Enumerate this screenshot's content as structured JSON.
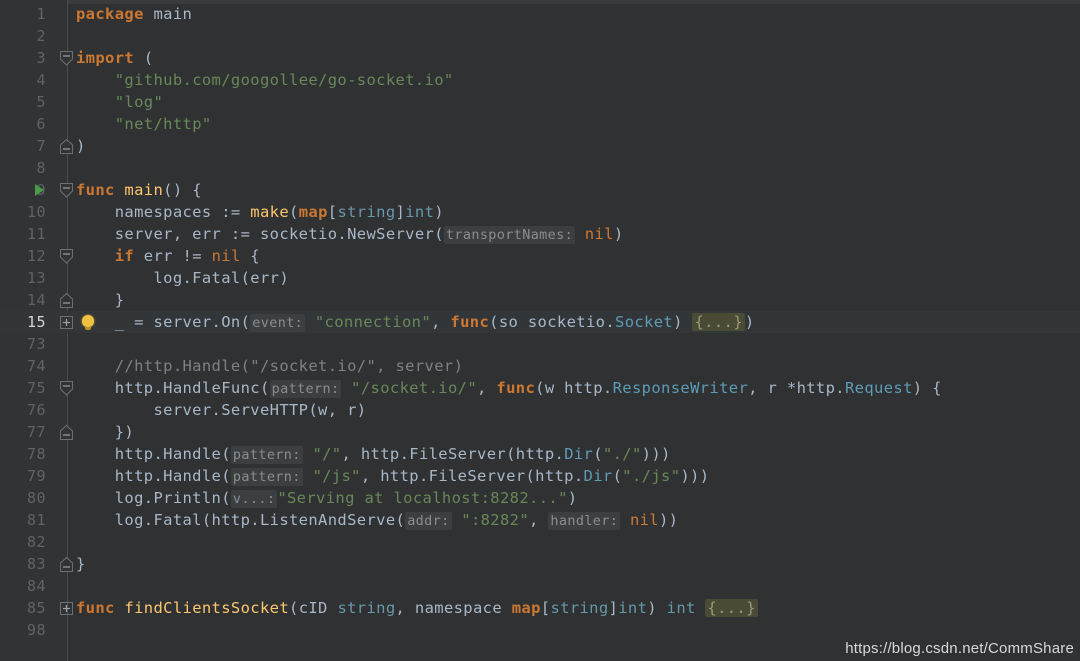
{
  "app": {
    "type": "code-editor",
    "language": "Go",
    "theme": "Darcula",
    "background": "#2f3133",
    "gutter_background": "#313335",
    "current_line_background": "#323639",
    "default_text_color": "#a9b7c6"
  },
  "colors": {
    "keyword": "#cc7832",
    "string": "#6a8759",
    "comment": "#808080",
    "type": "#6897a8",
    "function": "#ffc66d",
    "parameter_hint_bg": "#3c3f41",
    "parameter_hint_fg": "#8c8c8c",
    "folded_block_bg": "#4a4b35",
    "run_marker": "#4a9c4a",
    "bulb": "#f0c040",
    "line_number": "#606366",
    "current_line_number": "#d6d6d6"
  },
  "gutter": {
    "run_marker_line": 9,
    "bulb_line": 15,
    "fold_markers": [
      {
        "line": 3,
        "state": "expanded-start"
      },
      {
        "line": 7,
        "state": "expanded-end"
      },
      {
        "line": 9,
        "state": "expanded-start"
      },
      {
        "line": 12,
        "state": "expanded-start"
      },
      {
        "line": 14,
        "state": "expanded-end"
      },
      {
        "line": 15,
        "state": "collapsed"
      },
      {
        "line": 75,
        "state": "expanded-start"
      },
      {
        "line": 77,
        "state": "expanded-end"
      },
      {
        "line": 83,
        "state": "expanded-end"
      },
      {
        "line": 85,
        "state": "collapsed"
      }
    ]
  },
  "editor": {
    "current_line": 15,
    "lines": [
      {
        "n": "1",
        "tokens": [
          {
            "t": "package",
            "c": "kw"
          },
          {
            "t": " main",
            "c": "plain"
          }
        ]
      },
      {
        "n": "2",
        "tokens": []
      },
      {
        "n": "3",
        "tokens": [
          {
            "t": "import",
            "c": "kw"
          },
          {
            "t": " (",
            "c": "plain"
          }
        ]
      },
      {
        "n": "4",
        "tokens": [
          {
            "t": "    ",
            "c": "plain"
          },
          {
            "t": "\"github.com/googollee/go-socket.io\"",
            "c": "str"
          }
        ]
      },
      {
        "n": "5",
        "tokens": [
          {
            "t": "    ",
            "c": "plain"
          },
          {
            "t": "\"log\"",
            "c": "str"
          }
        ]
      },
      {
        "n": "6",
        "tokens": [
          {
            "t": "    ",
            "c": "plain"
          },
          {
            "t": "\"net/http\"",
            "c": "str"
          }
        ]
      },
      {
        "n": "7",
        "tokens": [
          {
            "t": ")",
            "c": "plain"
          }
        ]
      },
      {
        "n": "8",
        "tokens": []
      },
      {
        "n": "9",
        "tokens": [
          {
            "t": "func",
            "c": "kw"
          },
          {
            "t": " ",
            "c": "plain"
          },
          {
            "t": "main",
            "c": "fn"
          },
          {
            "t": "() {",
            "c": "plain"
          }
        ]
      },
      {
        "n": "10",
        "tokens": [
          {
            "t": "    namespaces := ",
            "c": "plain"
          },
          {
            "t": "make",
            "c": "builtin"
          },
          {
            "t": "(",
            "c": "plain"
          },
          {
            "t": "map",
            "c": "kw"
          },
          {
            "t": "[",
            "c": "plain"
          },
          {
            "t": "string",
            "c": "type"
          },
          {
            "t": "]",
            "c": "plain"
          },
          {
            "t": "int",
            "c": "type"
          },
          {
            "t": ")",
            "c": "plain"
          }
        ]
      },
      {
        "n": "11",
        "tokens": [
          {
            "t": "    server, err := socketio.NewServer(",
            "c": "plain"
          },
          {
            "t": "transportNames:",
            "c": "hint"
          },
          {
            "t": " ",
            "c": "plain"
          },
          {
            "t": "nil",
            "c": "kw2"
          },
          {
            "t": ")",
            "c": "plain"
          }
        ]
      },
      {
        "n": "12",
        "tokens": [
          {
            "t": "    ",
            "c": "plain"
          },
          {
            "t": "if",
            "c": "kw"
          },
          {
            "t": " err != ",
            "c": "plain"
          },
          {
            "t": "nil",
            "c": "kw2"
          },
          {
            "t": " {",
            "c": "plain"
          }
        ]
      },
      {
        "n": "13",
        "tokens": [
          {
            "t": "        log.Fatal(err)",
            "c": "plain"
          }
        ]
      },
      {
        "n": "14",
        "tokens": [
          {
            "t": "    }",
            "c": "plain"
          }
        ]
      },
      {
        "n": "15",
        "tokens": [
          {
            "t": "    _ = server.On(",
            "c": "plain"
          },
          {
            "t": "event:",
            "c": "hint"
          },
          {
            "t": " ",
            "c": "plain"
          },
          {
            "t": "\"connection\"",
            "c": "str"
          },
          {
            "t": ", ",
            "c": "plain"
          },
          {
            "t": "func",
            "c": "kw"
          },
          {
            "t": "(so socketio.",
            "c": "plain"
          },
          {
            "t": "Socket",
            "c": "typ2"
          },
          {
            "t": ") ",
            "c": "plain"
          },
          {
            "t": "{...}",
            "c": "fold-inline"
          },
          {
            "t": ")",
            "c": "plain"
          }
        ]
      },
      {
        "n": "73",
        "tokens": []
      },
      {
        "n": "74",
        "tokens": [
          {
            "t": "    //http.Handle(\"/socket.io/\", server)",
            "c": "cmt"
          }
        ]
      },
      {
        "n": "75",
        "tokens": [
          {
            "t": "    http.HandleFunc(",
            "c": "plain"
          },
          {
            "t": "pattern:",
            "c": "hint"
          },
          {
            "t": " ",
            "c": "plain"
          },
          {
            "t": "\"/socket.io/\"",
            "c": "str"
          },
          {
            "t": ", ",
            "c": "plain"
          },
          {
            "t": "func",
            "c": "kw"
          },
          {
            "t": "(w http.",
            "c": "plain"
          },
          {
            "t": "ResponseWriter",
            "c": "typ2"
          },
          {
            "t": ", r *http.",
            "c": "plain"
          },
          {
            "t": "Request",
            "c": "typ2"
          },
          {
            "t": ") {",
            "c": "plain"
          }
        ]
      },
      {
        "n": "76",
        "tokens": [
          {
            "t": "        server.ServeHTTP(w, r)",
            "c": "plain"
          }
        ]
      },
      {
        "n": "77",
        "tokens": [
          {
            "t": "    })",
            "c": "plain"
          }
        ]
      },
      {
        "n": "78",
        "tokens": [
          {
            "t": "    http.Handle(",
            "c": "plain"
          },
          {
            "t": "pattern:",
            "c": "hint"
          },
          {
            "t": " ",
            "c": "plain"
          },
          {
            "t": "\"/\"",
            "c": "str"
          },
          {
            "t": ", http.",
            "c": "plain"
          },
          {
            "t": "FileServer",
            "c": "plain"
          },
          {
            "t": "(http.",
            "c": "plain"
          },
          {
            "t": "Dir",
            "c": "typ2"
          },
          {
            "t": "(",
            "c": "plain"
          },
          {
            "t": "\"./\"",
            "c": "str"
          },
          {
            "t": ")))",
            "c": "plain"
          }
        ]
      },
      {
        "n": "79",
        "tokens": [
          {
            "t": "    http.Handle(",
            "c": "plain"
          },
          {
            "t": "pattern:",
            "c": "hint"
          },
          {
            "t": " ",
            "c": "plain"
          },
          {
            "t": "\"/js\"",
            "c": "str"
          },
          {
            "t": ", http.FileServer(http.",
            "c": "plain"
          },
          {
            "t": "Dir",
            "c": "typ2"
          },
          {
            "t": "(",
            "c": "plain"
          },
          {
            "t": "\"./js\"",
            "c": "str"
          },
          {
            "t": ")))",
            "c": "plain"
          }
        ]
      },
      {
        "n": "80",
        "tokens": [
          {
            "t": "    log.Println(",
            "c": "plain"
          },
          {
            "t": "v...:",
            "c": "hint"
          },
          {
            "t": "\"Serving at localhost:8282...\"",
            "c": "str"
          },
          {
            "t": ")",
            "c": "plain"
          }
        ]
      },
      {
        "n": "81",
        "tokens": [
          {
            "t": "    log.Fatal(http.ListenAndServe(",
            "c": "plain"
          },
          {
            "t": "addr:",
            "c": "hint"
          },
          {
            "t": " ",
            "c": "plain"
          },
          {
            "t": "\":8282\"",
            "c": "str"
          },
          {
            "t": ", ",
            "c": "plain"
          },
          {
            "t": "handler:",
            "c": "hint"
          },
          {
            "t": " ",
            "c": "plain"
          },
          {
            "t": "nil",
            "c": "kw2"
          },
          {
            "t": "))",
            "c": "plain"
          }
        ]
      },
      {
        "n": "82",
        "tokens": []
      },
      {
        "n": "83",
        "tokens": [
          {
            "t": "}",
            "c": "plain"
          }
        ]
      },
      {
        "n": "84",
        "tokens": []
      },
      {
        "n": "85",
        "tokens": [
          {
            "t": "func",
            "c": "kw"
          },
          {
            "t": " ",
            "c": "plain"
          },
          {
            "t": "findClientsSocket",
            "c": "fn"
          },
          {
            "t": "(cID ",
            "c": "plain"
          },
          {
            "t": "string",
            "c": "type"
          },
          {
            "t": ", namespace ",
            "c": "plain"
          },
          {
            "t": "map",
            "c": "kw"
          },
          {
            "t": "[",
            "c": "plain"
          },
          {
            "t": "string",
            "c": "type"
          },
          {
            "t": "]",
            "c": "plain"
          },
          {
            "t": "int",
            "c": "type"
          },
          {
            "t": ") ",
            "c": "plain"
          },
          {
            "t": "int",
            "c": "type"
          },
          {
            "t": " ",
            "c": "plain"
          },
          {
            "t": "{...}",
            "c": "fold-inline"
          }
        ]
      },
      {
        "n": "98",
        "tokens": []
      }
    ]
  },
  "watermark": {
    "text": "https://blog.csdn.net/CommShare"
  }
}
